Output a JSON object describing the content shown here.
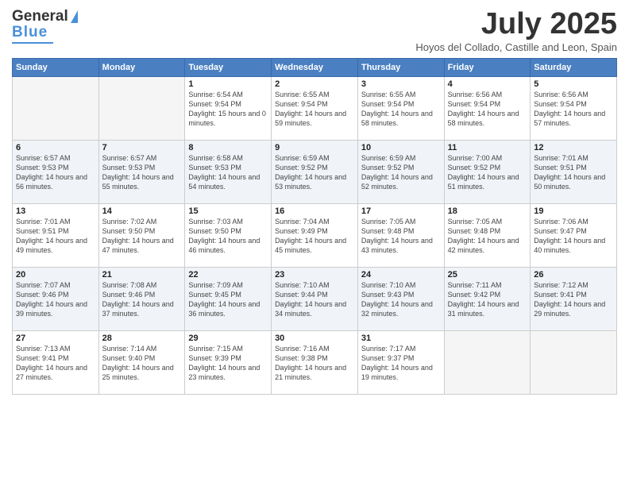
{
  "logo": {
    "line1": "General",
    "line2": "Blue"
  },
  "title": "July 2025",
  "subtitle": "Hoyos del Collado, Castille and Leon, Spain",
  "days_of_week": [
    "Sunday",
    "Monday",
    "Tuesday",
    "Wednesday",
    "Thursday",
    "Friday",
    "Saturday"
  ],
  "weeks": [
    [
      {
        "day": "",
        "sunrise": "",
        "sunset": "",
        "daylight": ""
      },
      {
        "day": "",
        "sunrise": "",
        "sunset": "",
        "daylight": ""
      },
      {
        "day": "1",
        "sunrise": "Sunrise: 6:54 AM",
        "sunset": "Sunset: 9:54 PM",
        "daylight": "Daylight: 15 hours and 0 minutes."
      },
      {
        "day": "2",
        "sunrise": "Sunrise: 6:55 AM",
        "sunset": "Sunset: 9:54 PM",
        "daylight": "Daylight: 14 hours and 59 minutes."
      },
      {
        "day": "3",
        "sunrise": "Sunrise: 6:55 AM",
        "sunset": "Sunset: 9:54 PM",
        "daylight": "Daylight: 14 hours and 58 minutes."
      },
      {
        "day": "4",
        "sunrise": "Sunrise: 6:56 AM",
        "sunset": "Sunset: 9:54 PM",
        "daylight": "Daylight: 14 hours and 58 minutes."
      },
      {
        "day": "5",
        "sunrise": "Sunrise: 6:56 AM",
        "sunset": "Sunset: 9:54 PM",
        "daylight": "Daylight: 14 hours and 57 minutes."
      }
    ],
    [
      {
        "day": "6",
        "sunrise": "Sunrise: 6:57 AM",
        "sunset": "Sunset: 9:53 PM",
        "daylight": "Daylight: 14 hours and 56 minutes."
      },
      {
        "day": "7",
        "sunrise": "Sunrise: 6:57 AM",
        "sunset": "Sunset: 9:53 PM",
        "daylight": "Daylight: 14 hours and 55 minutes."
      },
      {
        "day": "8",
        "sunrise": "Sunrise: 6:58 AM",
        "sunset": "Sunset: 9:53 PM",
        "daylight": "Daylight: 14 hours and 54 minutes."
      },
      {
        "day": "9",
        "sunrise": "Sunrise: 6:59 AM",
        "sunset": "Sunset: 9:52 PM",
        "daylight": "Daylight: 14 hours and 53 minutes."
      },
      {
        "day": "10",
        "sunrise": "Sunrise: 6:59 AM",
        "sunset": "Sunset: 9:52 PM",
        "daylight": "Daylight: 14 hours and 52 minutes."
      },
      {
        "day": "11",
        "sunrise": "Sunrise: 7:00 AM",
        "sunset": "Sunset: 9:52 PM",
        "daylight": "Daylight: 14 hours and 51 minutes."
      },
      {
        "day": "12",
        "sunrise": "Sunrise: 7:01 AM",
        "sunset": "Sunset: 9:51 PM",
        "daylight": "Daylight: 14 hours and 50 minutes."
      }
    ],
    [
      {
        "day": "13",
        "sunrise": "Sunrise: 7:01 AM",
        "sunset": "Sunset: 9:51 PM",
        "daylight": "Daylight: 14 hours and 49 minutes."
      },
      {
        "day": "14",
        "sunrise": "Sunrise: 7:02 AM",
        "sunset": "Sunset: 9:50 PM",
        "daylight": "Daylight: 14 hours and 47 minutes."
      },
      {
        "day": "15",
        "sunrise": "Sunrise: 7:03 AM",
        "sunset": "Sunset: 9:50 PM",
        "daylight": "Daylight: 14 hours and 46 minutes."
      },
      {
        "day": "16",
        "sunrise": "Sunrise: 7:04 AM",
        "sunset": "Sunset: 9:49 PM",
        "daylight": "Daylight: 14 hours and 45 minutes."
      },
      {
        "day": "17",
        "sunrise": "Sunrise: 7:05 AM",
        "sunset": "Sunset: 9:48 PM",
        "daylight": "Daylight: 14 hours and 43 minutes."
      },
      {
        "day": "18",
        "sunrise": "Sunrise: 7:05 AM",
        "sunset": "Sunset: 9:48 PM",
        "daylight": "Daylight: 14 hours and 42 minutes."
      },
      {
        "day": "19",
        "sunrise": "Sunrise: 7:06 AM",
        "sunset": "Sunset: 9:47 PM",
        "daylight": "Daylight: 14 hours and 40 minutes."
      }
    ],
    [
      {
        "day": "20",
        "sunrise": "Sunrise: 7:07 AM",
        "sunset": "Sunset: 9:46 PM",
        "daylight": "Daylight: 14 hours and 39 minutes."
      },
      {
        "day": "21",
        "sunrise": "Sunrise: 7:08 AM",
        "sunset": "Sunset: 9:46 PM",
        "daylight": "Daylight: 14 hours and 37 minutes."
      },
      {
        "day": "22",
        "sunrise": "Sunrise: 7:09 AM",
        "sunset": "Sunset: 9:45 PM",
        "daylight": "Daylight: 14 hours and 36 minutes."
      },
      {
        "day": "23",
        "sunrise": "Sunrise: 7:10 AM",
        "sunset": "Sunset: 9:44 PM",
        "daylight": "Daylight: 14 hours and 34 minutes."
      },
      {
        "day": "24",
        "sunrise": "Sunrise: 7:10 AM",
        "sunset": "Sunset: 9:43 PM",
        "daylight": "Daylight: 14 hours and 32 minutes."
      },
      {
        "day": "25",
        "sunrise": "Sunrise: 7:11 AM",
        "sunset": "Sunset: 9:42 PM",
        "daylight": "Daylight: 14 hours and 31 minutes."
      },
      {
        "day": "26",
        "sunrise": "Sunrise: 7:12 AM",
        "sunset": "Sunset: 9:41 PM",
        "daylight": "Daylight: 14 hours and 29 minutes."
      }
    ],
    [
      {
        "day": "27",
        "sunrise": "Sunrise: 7:13 AM",
        "sunset": "Sunset: 9:41 PM",
        "daylight": "Daylight: 14 hours and 27 minutes."
      },
      {
        "day": "28",
        "sunrise": "Sunrise: 7:14 AM",
        "sunset": "Sunset: 9:40 PM",
        "daylight": "Daylight: 14 hours and 25 minutes."
      },
      {
        "day": "29",
        "sunrise": "Sunrise: 7:15 AM",
        "sunset": "Sunset: 9:39 PM",
        "daylight": "Daylight: 14 hours and 23 minutes."
      },
      {
        "day": "30",
        "sunrise": "Sunrise: 7:16 AM",
        "sunset": "Sunset: 9:38 PM",
        "daylight": "Daylight: 14 hours and 21 minutes."
      },
      {
        "day": "31",
        "sunrise": "Sunrise: 7:17 AM",
        "sunset": "Sunset: 9:37 PM",
        "daylight": "Daylight: 14 hours and 19 minutes."
      },
      {
        "day": "",
        "sunrise": "",
        "sunset": "",
        "daylight": ""
      },
      {
        "day": "",
        "sunrise": "",
        "sunset": "",
        "daylight": ""
      }
    ]
  ]
}
